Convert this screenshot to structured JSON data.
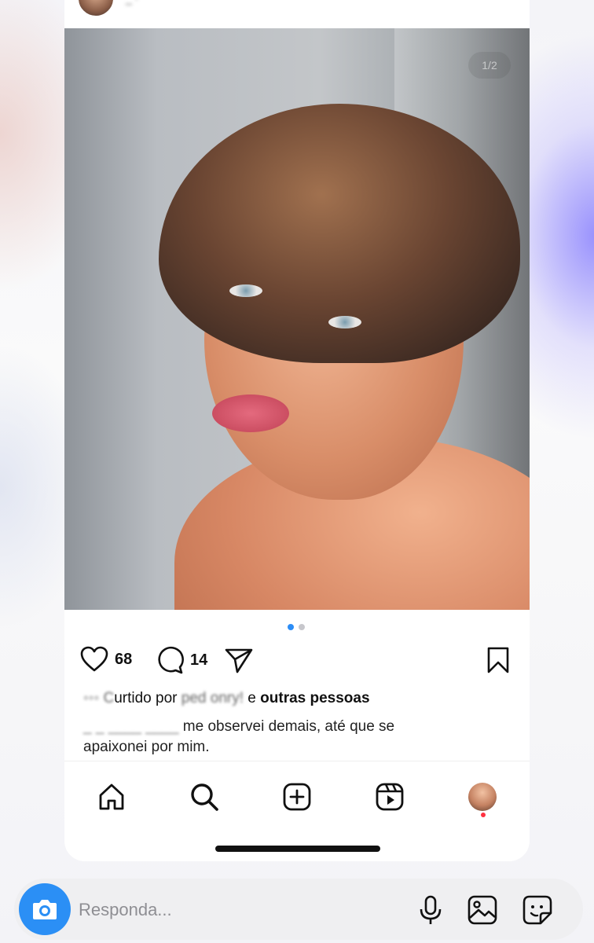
{
  "post": {
    "username": "_ ·",
    "page_counter": "1/2",
    "likes_count": "68",
    "comments_count": "14",
    "liked_by_blurred": "◦◦◦ C",
    "liked_by_prefix": "urtido por",
    "liked_by_name_blurred": "ped  onry!",
    "liked_by_and": "e",
    "liked_by_others": "outras pessoas",
    "caption_user_blurred": "_ _  ____  ____",
    "caption_text_line1": "me observei demais, até que se",
    "caption_text_line2": "apaixonei por mim."
  },
  "carousel": {
    "total": 2,
    "active": 1
  },
  "tabs": [
    {
      "id": "home",
      "icon": "home-icon"
    },
    {
      "id": "search",
      "icon": "search-icon"
    },
    {
      "id": "create",
      "icon": "plus-square-icon"
    },
    {
      "id": "reels",
      "icon": "reels-icon"
    },
    {
      "id": "profile",
      "icon": "avatar"
    }
  ],
  "reply": {
    "placeholder": "Responda..."
  },
  "colors": {
    "accent": "#2b8ff5",
    "notification": "#ff3040"
  }
}
